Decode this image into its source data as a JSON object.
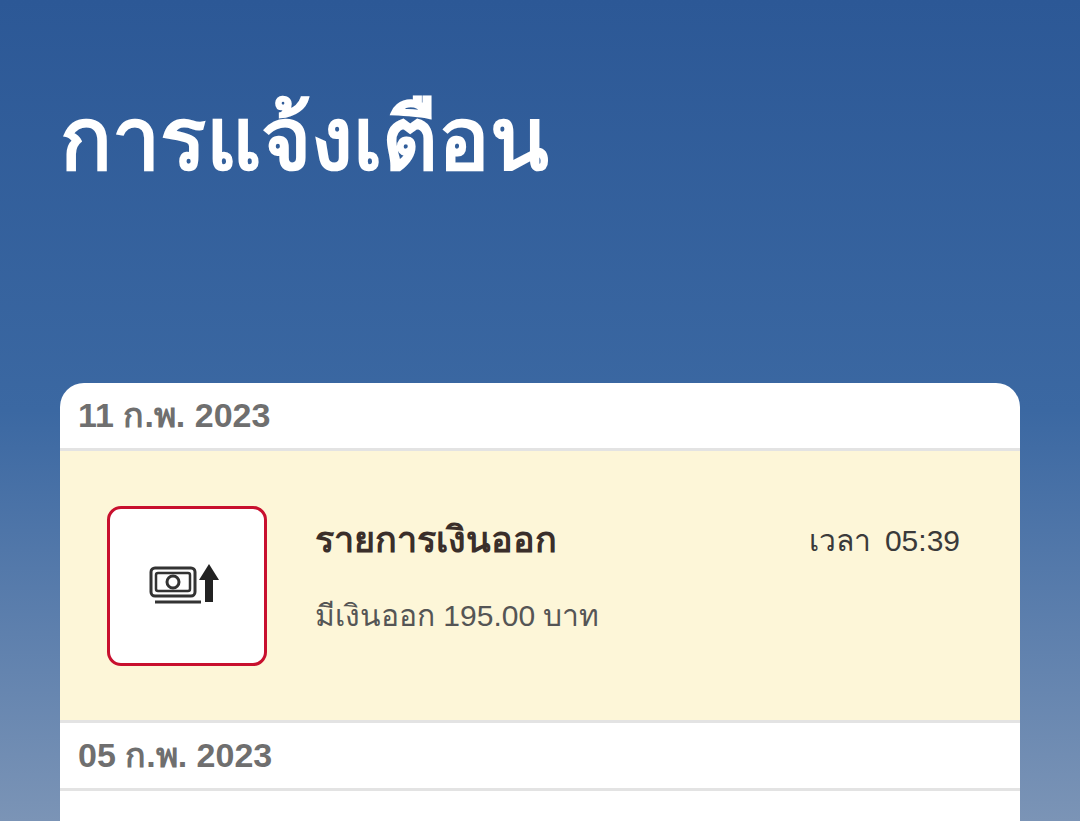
{
  "header": {
    "title": "การแจ้งเตือน"
  },
  "groups": [
    {
      "date": "11 ก.พ. 2023",
      "items": [
        {
          "title": "รายการเงินออก",
          "detail": "มีเงินออก 195.00 บาท",
          "time_label": "เวลา",
          "time": "05:39",
          "unread": true
        }
      ]
    },
    {
      "date": "05 ก.พ. 2023",
      "items": []
    }
  ]
}
